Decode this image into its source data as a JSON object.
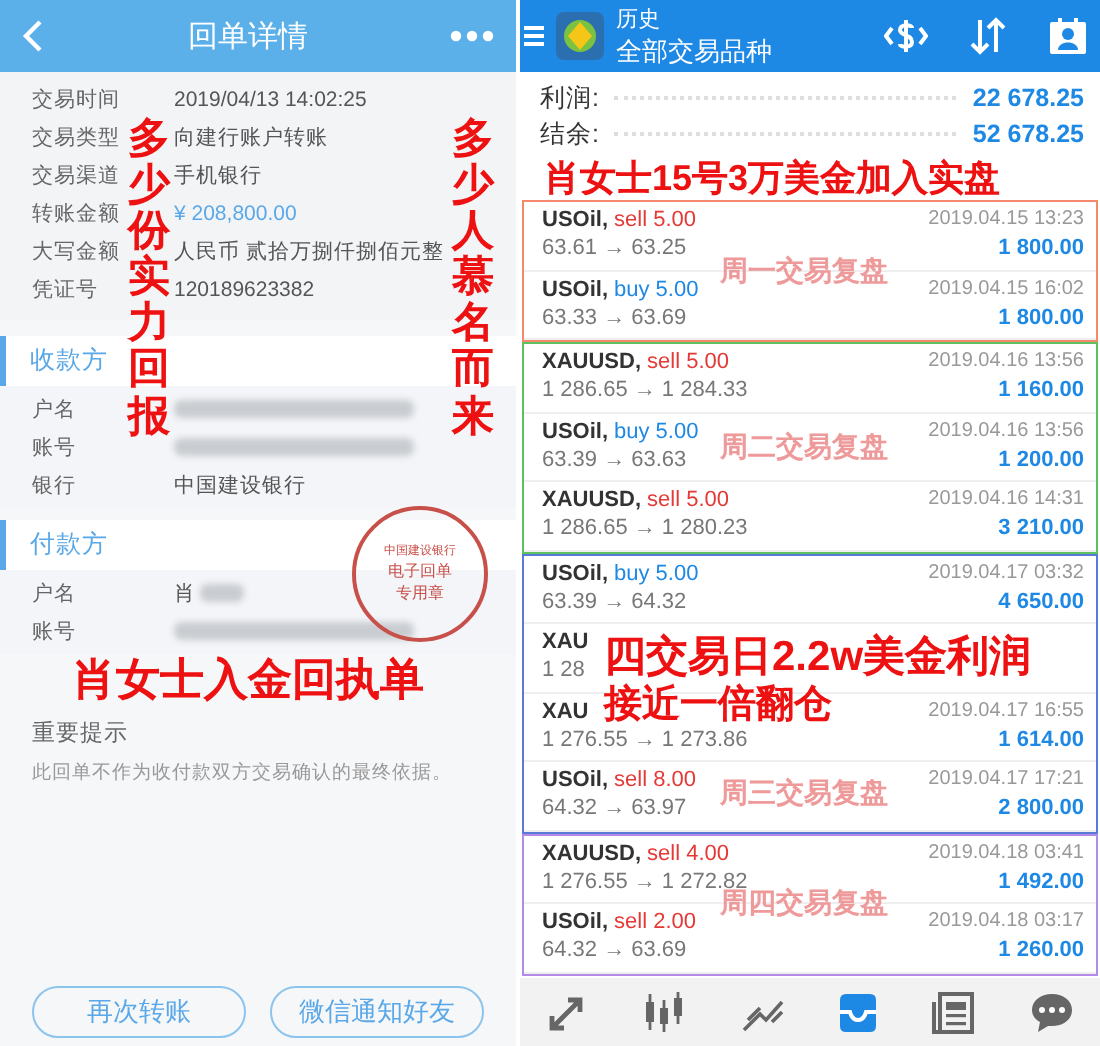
{
  "receipt": {
    "title": "回单详情",
    "details": [
      {
        "label": "交易时间",
        "value": "2019/04/13 14:02:25",
        "kind": "plain"
      },
      {
        "label": "交易类型",
        "value": "向建行账户转账",
        "kind": "plain"
      },
      {
        "label": "交易渠道",
        "value": "手机银行",
        "kind": "plain"
      },
      {
        "label": "转账金额",
        "value": "¥ 208,800.00",
        "kind": "amount"
      },
      {
        "label": "大写金额",
        "value": "人民币 贰拾万捌仟捌佰元整",
        "kind": "plain"
      },
      {
        "label": "凭证号",
        "value": "120189623382",
        "kind": "plain"
      }
    ],
    "payee": {
      "title": "收款方",
      "rows": [
        {
          "label": "户名",
          "redacted": true
        },
        {
          "label": "账号",
          "redacted": true
        },
        {
          "label": "银行",
          "value": "中国建设银行"
        }
      ]
    },
    "payer": {
      "title": "付款方",
      "rows": [
        {
          "label": "户名",
          "value": "肖",
          "redacted": true
        },
        {
          "label": "账号",
          "redacted": true
        }
      ]
    },
    "seal": {
      "bank": "中国建设银行",
      "line_1": "电子回单",
      "line_2": "专用章"
    },
    "notice": {
      "title": "重要提示",
      "text": "此回单不作为收付款双方交易确认的最终依据。"
    },
    "buttons": [
      "再次转账",
      "微信通知好友"
    ],
    "captions": [
      {
        "text": "多少份实力回报",
        "vertical": true
      },
      {
        "text": "多少人慕名而来",
        "vertical": true
      },
      {
        "text": "肖女士入金回执单",
        "vertical": false
      }
    ]
  },
  "history": {
    "title": "历史",
    "subtitle": "全部交易品种",
    "summary": [
      {
        "label": "利润:",
        "value": "22 678.25"
      },
      {
        "label": "结余:",
        "value": "52 678.25"
      }
    ],
    "groups": [
      {
        "color": "#f4896b",
        "label": "周一交易复盘",
        "rows": [
          {
            "symbol": "USOil,",
            "action": "sell 5.00",
            "color": "#e53935",
            "prices": "63.61 → 63.25",
            "time": "2019.04.15 13:23",
            "profit": "1 800.00"
          },
          {
            "symbol": "USOil,",
            "action": "buy 5.00",
            "color": "#1e88e5",
            "prices": "63.33 → 63.69",
            "time": "2019.04.15 16:02",
            "profit": "1 800.00"
          }
        ]
      },
      {
        "color": "#5cc060",
        "label": "周二交易复盘",
        "rows": [
          {
            "symbol": "XAUUSD,",
            "action": "sell 5.00",
            "color": "#e53935",
            "prices": "1 286.65 → 1 284.33",
            "time": "2019.04.16 13:56",
            "profit": "1 160.00"
          },
          {
            "symbol": "USOil,",
            "action": "buy 5.00",
            "color": "#1e88e5",
            "prices": "63.39 → 63.63",
            "time": "2019.04.16 13:56",
            "profit": "1 200.00"
          },
          {
            "symbol": "XAUUSD,",
            "action": "sell 5.00",
            "color": "#e53935",
            "prices": "1 286.65 → 1 280.23",
            "time": "2019.04.16 14:31",
            "profit": "3 210.00"
          }
        ]
      },
      {
        "color": "#5a78d8",
        "label": "周三交易复盘",
        "rows": [
          {
            "symbol": "USOil,",
            "action": "buy 5.00",
            "color": "#1e88e5",
            "prices": "63.39 → 64.32",
            "time": "2019.04.17 03:32",
            "profit": "4 650.00"
          },
          {
            "symbol": "XAU",
            "prices": "1 28"
          },
          {
            "symbol": "XAU",
            "prices": "1 276.55 → 1 273.86",
            "time": "2019.04.17 16:55",
            "profit": "1 614.00"
          },
          {
            "symbol": "USOil,",
            "action": "sell 8.00",
            "color": "#e53935",
            "prices": "64.32 → 63.97",
            "time": "2019.04.17 17:21",
            "profit": "2 800.00"
          }
        ]
      },
      {
        "color": "#b48ae8",
        "label": "周四交易复盘",
        "rows": [
          {
            "symbol": "XAUUSD,",
            "action": "sell 4.00",
            "color": "#e53935",
            "prices": "1 276.55 → 1 272.82",
            "time": "2019.04.18 03:41",
            "profit": "1 492.00"
          },
          {
            "symbol": "USOil,",
            "action": "sell 2.00",
            "color": "#e53935",
            "prices": "64.32 → 63.69",
            "time": "2019.04.18 03:17",
            "profit": "1 260.00"
          }
        ]
      }
    ],
    "nav": [
      {
        "kind": "trade",
        "selected": false
      },
      {
        "kind": "quotes",
        "selected": false
      },
      {
        "kind": "chart",
        "selected": false
      },
      {
        "kind": "history",
        "selected": true
      },
      {
        "kind": "news",
        "selected": false
      },
      {
        "kind": "chat",
        "selected": false
      }
    ],
    "captions": [
      {
        "text": "肖女士15号3万美金加入实盘"
      },
      {
        "text": "四交易日2.2w美金利润"
      },
      {
        "text": "接近一倍翻仓"
      }
    ]
  }
}
